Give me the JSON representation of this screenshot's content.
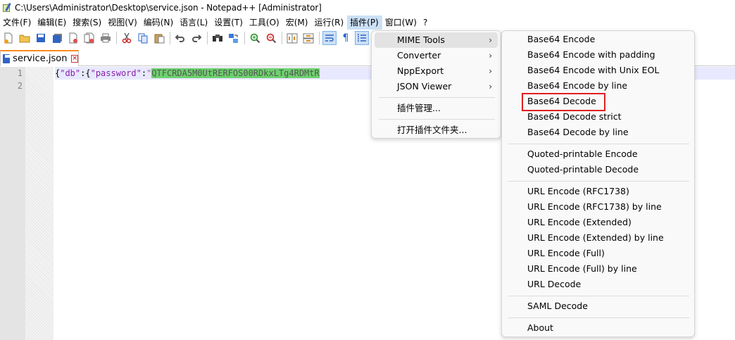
{
  "window": {
    "title": "C:\\Users\\Administrator\\Desktop\\service.json - Notepad++ [Administrator]"
  },
  "menubar": [
    "文件(F)",
    "编辑(E)",
    "搜索(S)",
    "视图(V)",
    "编码(N)",
    "语言(L)",
    "设置(T)",
    "工具(O)",
    "宏(M)",
    "运行(R)",
    "插件(P)",
    "窗口(W)",
    "?"
  ],
  "toolbar": {
    "icons": [
      "new-file-icon",
      "open-file-icon",
      "save-icon",
      "save-all-icon",
      "close-icon",
      "close-all-icon",
      "print-icon",
      "cut-icon",
      "copy-icon",
      "paste-icon",
      "undo-icon",
      "redo-icon",
      "find-icon",
      "replace-icon",
      "zoom-in-icon",
      "zoom-out-icon",
      "sync-v-icon",
      "sync-h-icon",
      "word-wrap-icon",
      "show-all-chars-icon",
      "indent-guide-icon"
    ]
  },
  "tab": {
    "label": "service.json",
    "close_glyph": "×"
  },
  "editor": {
    "line_numbers": [
      "1",
      "2"
    ],
    "line1": {
      "open": "{",
      "key1": "\"db\"",
      "colon1": ":{",
      "key2": "\"password\"",
      "colon2": ":",
      "quote": "\"",
      "value": "QTFCRDA5M0UtRERFOS00RDkxLTg4RDMtR"
    }
  },
  "plugins_menu": {
    "items": [
      {
        "label": "MIME Tools",
        "arrow": "›"
      },
      {
        "label": "Converter",
        "arrow": "›"
      },
      {
        "label": "NppExport",
        "arrow": "›"
      },
      {
        "label": "JSON Viewer",
        "arrow": "›"
      },
      {
        "label": "插件管理..."
      },
      {
        "label": "打开插件文件夹..."
      }
    ]
  },
  "mime_menu": {
    "items": [
      "Base64 Encode",
      "Base64 Encode with padding",
      "Base64 Encode with Unix EOL",
      "Base64 Encode by line",
      "Base64 Decode",
      "Base64 Decode strict",
      "Base64 Decode by line",
      "Quoted-printable Encode",
      "Quoted-printable Decode",
      "URL Encode (RFC1738)",
      "URL Encode (RFC1738) by line",
      "URL Encode (Extended)",
      "URL Encode (Extended) by line",
      "URL Encode (Full)",
      "URL Encode (Full) by line",
      "URL Decode",
      "SAML Decode",
      "About"
    ]
  },
  "colors": {
    "highlight_value": "#6cd16c",
    "json_key": "#8a1fa8",
    "tab_accent": "#fa8c1e",
    "menu_hover": "#cce0f7",
    "annotation_box": "#e02020"
  }
}
